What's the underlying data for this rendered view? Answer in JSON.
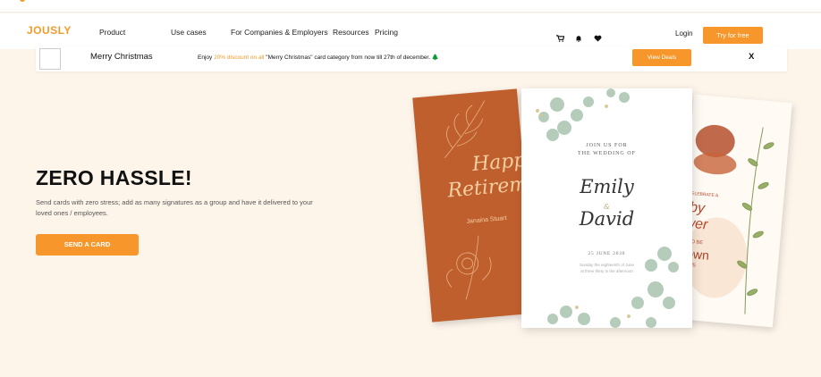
{
  "nav": {
    "logo": "JOUSLY",
    "items": [
      "Product",
      "Use cases",
      "For Companies & Employers",
      "Resources",
      "Pricing"
    ],
    "login": "Login",
    "try_free": "Try for free",
    "icons": [
      "cart-icon",
      "bell-icon",
      "heart-icon"
    ]
  },
  "banner": {
    "title": "Merry Christmas",
    "msg_pre": "Enjoy ",
    "msg_pct": "20% discount on all",
    "msg_post": " \"Merry Christmas\" card category from now till 27th of december. ",
    "msg_icon": "🌲",
    "deals": "View Deals",
    "close": "X"
  },
  "hero": {
    "title": "ZERO HASSLE!",
    "subtitle": "Send cards with zero stress; add as many signatures as a group and have it delivered to your loved ones / employees.",
    "cta": "SEND A CARD"
  },
  "cards": {
    "retirement": {
      "line1": "Happ",
      "line2": "Retirem",
      "name": "Janaina Stuart"
    },
    "wedding": {
      "join": "JOIN US FOR\nTHE WEDDING OF",
      "name1": "Emily",
      "amp": "&",
      "name2": "David",
      "date": "25   JUNE   2030",
      "small": "Sunday the eighteenth of June\nat three thirty in the afternoon"
    },
    "baby": {
      "celebrate": "CELEBRATE A",
      "by": "by",
      "wer": "wer",
      "to_be": "T TO BE",
      "rown": "rown",
      "ne": "NE 25"
    }
  },
  "colors": {
    "accent": "#f7962a",
    "background": "#fdf5ea"
  }
}
